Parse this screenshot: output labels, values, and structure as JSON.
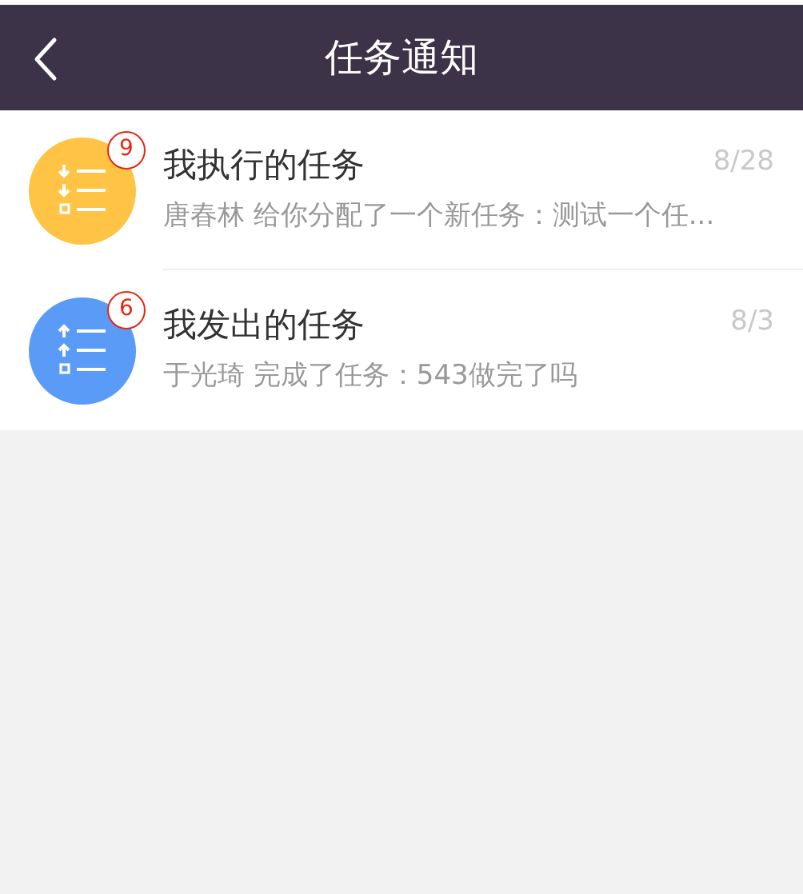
{
  "header": {
    "title": "任务通知"
  },
  "items": [
    {
      "kind": "incoming",
      "color": "#ffc445",
      "badge": "9",
      "title": "我执行的任务",
      "date": "8/28",
      "message": "唐春林 给你分配了一个新任务：测试一个任..."
    },
    {
      "kind": "outgoing",
      "color": "#5b9bf8",
      "badge": "6",
      "title": "我发出的任务",
      "date": "8/3",
      "message": "于光琦 完成了任务：543做完了吗"
    }
  ]
}
